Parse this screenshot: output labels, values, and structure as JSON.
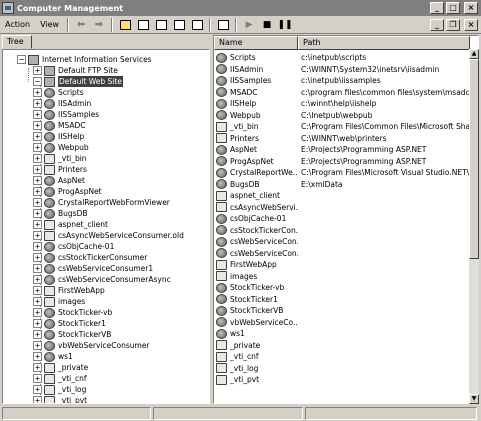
{
  "window": {
    "title": "Computer Management"
  },
  "title_buttons": {
    "minimize": "_",
    "maximize": "□",
    "close": "×"
  },
  "inner_buttons": {
    "minimize": "_",
    "restore": "❐",
    "close": "×"
  },
  "menu": {
    "action": "Action",
    "view": "View"
  },
  "toolbar_icons": [
    "back-arrow-icon",
    "forward-arrow-icon",
    "up-folder-icon",
    "show-tree-icon",
    "properties-icon",
    "refresh-icon",
    "export-icon",
    "help-icon",
    "play-icon",
    "stop-icon",
    "pause-icon"
  ],
  "tree": {
    "tab_label": "Tree",
    "root": "Internet Information Services",
    "ftp": "Default FTP Site",
    "web": "Default Web Site",
    "children": [
      "Scripts",
      "IISAdmin",
      "IISSamples",
      "MSADC",
      "IISHelp",
      "Webpub",
      "_vti_bin",
      "Printers",
      "AspNet",
      "ProgAspNet",
      "CrystalReportWebFormViewer",
      "BugsDB",
      "aspnet_client",
      "csAsyncWebServiceConsumer.old",
      "csObjCache-01",
      "csStockTickerConsumer",
      "csWebServiceConsumer1",
      "csWebServiceConsumerAsync",
      "FirstWebApp",
      "images",
      "StockTicker-vb",
      "StockTicker1",
      "StockTickerVB",
      "vbWebServiceConsumer",
      "ws1",
      "_private",
      "_vti_cnf",
      "_vti_log",
      "_vti_pvt"
    ],
    "child_icons": [
      "globe-icon",
      "globe-icon",
      "globe-icon",
      "globe-icon",
      "globe-icon",
      "globe-icon",
      "folder-icon",
      "folder-icon",
      "globe-icon",
      "globe-icon",
      "globe-icon",
      "globe-icon",
      "folder-icon",
      "folder-icon",
      "globe-icon",
      "globe-icon",
      "globe-icon",
      "globe-icon",
      "folder-icon",
      "folder-icon",
      "globe-icon",
      "globe-icon",
      "globe-icon",
      "globe-icon",
      "globe-icon",
      "folder-icon",
      "folder-icon",
      "folder-icon",
      "folder-icon"
    ]
  },
  "list": {
    "col_name": "Name",
    "col_path": "Path",
    "rows": [
      {
        "name": "Scripts",
        "path": "c:\\inetpub\\scripts",
        "icon": "globe-icon"
      },
      {
        "name": "IISAdmin",
        "path": "C:\\WINNT\\System32\\inetsrv\\iisadmin",
        "icon": "globe-icon"
      },
      {
        "name": "IISSamples",
        "path": "c:\\inetpub\\iissamples",
        "icon": "globe-icon"
      },
      {
        "name": "MSADC",
        "path": "c:\\program files\\common files\\system\\msadc",
        "icon": "globe-icon"
      },
      {
        "name": "IISHelp",
        "path": "c:\\winnt\\help\\iishelp",
        "icon": "globe-icon"
      },
      {
        "name": "Webpub",
        "path": "C:\\Inetpub\\webpub",
        "icon": "globe-icon"
      },
      {
        "name": "_vti_bin",
        "path": "C:\\Program Files\\Common Files\\Microsoft Shared\\",
        "icon": "folder-icon"
      },
      {
        "name": "Printers",
        "path": "C:\\WINNT\\web\\printers",
        "icon": "folder-icon"
      },
      {
        "name": "AspNet",
        "path": "E:\\Projects\\Programming ASP.NET",
        "icon": "globe-icon"
      },
      {
        "name": "ProgAspNet",
        "path": "E:\\Projects\\Programming ASP.NET",
        "icon": "globe-icon"
      },
      {
        "name": "CrystalReportWe...",
        "path": "C:\\Program Files\\Microsoft Visual Studio.NET\\Crys",
        "icon": "globe-icon"
      },
      {
        "name": "BugsDB",
        "path": "E:\\xmlData",
        "icon": "globe-icon"
      },
      {
        "name": "aspnet_client",
        "path": "",
        "icon": "folder-icon"
      },
      {
        "name": "csAsyncWebServi...",
        "path": "",
        "icon": "folder-icon"
      },
      {
        "name": "csObjCache-01",
        "path": "",
        "icon": "globe-icon"
      },
      {
        "name": "csStockTickerCon...",
        "path": "",
        "icon": "globe-icon"
      },
      {
        "name": "csWebServiceCon...",
        "path": "",
        "icon": "globe-icon"
      },
      {
        "name": "csWebServiceCon...",
        "path": "",
        "icon": "globe-icon"
      },
      {
        "name": "FirstWebApp",
        "path": "",
        "icon": "folder-icon"
      },
      {
        "name": "images",
        "path": "",
        "icon": "folder-icon"
      },
      {
        "name": "StockTicker-vb",
        "path": "",
        "icon": "globe-icon"
      },
      {
        "name": "StockTicker1",
        "path": "",
        "icon": "globe-icon"
      },
      {
        "name": "StockTickerVB",
        "path": "",
        "icon": "globe-icon"
      },
      {
        "name": "vbWebServiceCo...",
        "path": "",
        "icon": "globe-icon"
      },
      {
        "name": "ws1",
        "path": "",
        "icon": "globe-icon"
      },
      {
        "name": "_private",
        "path": "",
        "icon": "folder-icon"
      },
      {
        "name": "_vti_cnf",
        "path": "",
        "icon": "folder-icon"
      },
      {
        "name": "_vti_log",
        "path": "",
        "icon": "folder-icon"
      },
      {
        "name": "_vti_pvt",
        "path": "",
        "icon": "folder-icon"
      }
    ]
  },
  "colors": {
    "titlebar": "#808080",
    "face": "#d4d0c8",
    "selection": "#404040"
  }
}
